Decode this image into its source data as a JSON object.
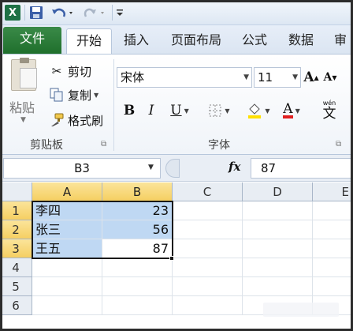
{
  "ribbon_tabs": [
    {
      "label": "文件"
    },
    {
      "label": "开始"
    },
    {
      "label": "插入"
    },
    {
      "label": "页面布局"
    },
    {
      "label": "公式"
    },
    {
      "label": "数据"
    },
    {
      "label": "审"
    }
  ],
  "clipboard_group": {
    "paste_label": "粘贴",
    "cut_label": "剪切",
    "copy_label": "复制",
    "format_painter_label": "格式刷",
    "group_label": "剪贴板"
  },
  "font_group": {
    "font_name": "宋体",
    "font_size": "11",
    "bold": "B",
    "italic": "I",
    "underline": "U",
    "font_color_letter": "A",
    "grow_font": "A",
    "shrink_font": "A",
    "phonetic": "文",
    "phonetic_top": "wén",
    "group_label": "字体",
    "font_color": "#e02020",
    "fill_color": "#ffe000"
  },
  "formula_bar": {
    "name_box": "B3",
    "fx": "fx",
    "value": "87"
  },
  "sheet": {
    "columns": [
      "A",
      "B",
      "C",
      "D",
      "E"
    ],
    "rows": [
      "1",
      "2",
      "3",
      "4",
      "5",
      "6"
    ],
    "data": [
      {
        "name": "李四",
        "value": "23"
      },
      {
        "name": "张三",
        "value": "56"
      },
      {
        "name": "王五",
        "value": "87"
      }
    ]
  },
  "colors": {
    "selection_fill": "#bfd8f3",
    "header_selected": "#f5cf62",
    "file_tab": "#2a7d3a"
  }
}
